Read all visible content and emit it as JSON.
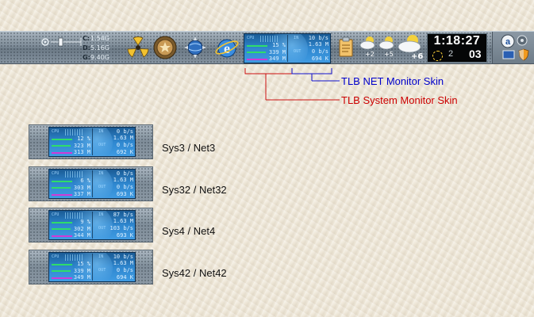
{
  "taskbar": {
    "drives": [
      {
        "letter": "C:",
        "free": "1.54G"
      },
      {
        "letter": "D:",
        "free": "5.16G"
      },
      {
        "letter": "G:",
        "free": "9.40G"
      }
    ],
    "weather": [
      {
        "label": "+2"
      },
      {
        "label": "+5"
      },
      {
        "label": "+6"
      }
    ],
    "clock": {
      "time": "1:18:27",
      "date": "2",
      "day": "03"
    }
  },
  "monitor_skin": {
    "cpu_label": "CPU",
    "in_label": "IN",
    "out_label": "OUT",
    "in_rate": "10 b/s",
    "in_total": "1.63 M",
    "cpu_pct": "15 %",
    "out_rate": "0 b/s",
    "mem_used": "339 M",
    "mem_total": "349 M",
    "out_total": "694 K"
  },
  "annotations": {
    "net": {
      "text": "TLB NET Monitor Skin",
      "color": "#0000cc"
    },
    "sys": {
      "text": "TLB System Monitor Skin",
      "color": "#cc0000"
    }
  },
  "samples": [
    {
      "label": "Sys3 / Net3",
      "in_rate": "0 b/s",
      "in_total": "1.63 M",
      "cpu_pct": "12 %",
      "out_rate": "0 b/s",
      "mem_used": "323 M",
      "mem_total": "313 M",
      "out_total": "692 K"
    },
    {
      "label": "Sys32 / Net32",
      "in_rate": "0 b/s",
      "in_total": "1.63 M",
      "cpu_pct": "6 %",
      "out_rate": "0 b/s",
      "mem_used": "303 M",
      "mem_total": "337 M",
      "out_total": "693 K"
    },
    {
      "label": "Sys4 / Net4",
      "in_rate": "87 b/s",
      "in_total": "1.63 M",
      "cpu_pct": "9 %",
      "out_rate": "103 b/s",
      "mem_used": "302 M",
      "mem_total": "344 M",
      "out_total": "693 K"
    },
    {
      "label": "Sys42 / Net42",
      "in_rate": "10 b/s",
      "in_total": "1.63 M",
      "cpu_pct": "15 %",
      "out_rate": "0 b/s",
      "mem_used": "339 M",
      "mem_total": "349 M",
      "out_total": "694 K"
    }
  ]
}
